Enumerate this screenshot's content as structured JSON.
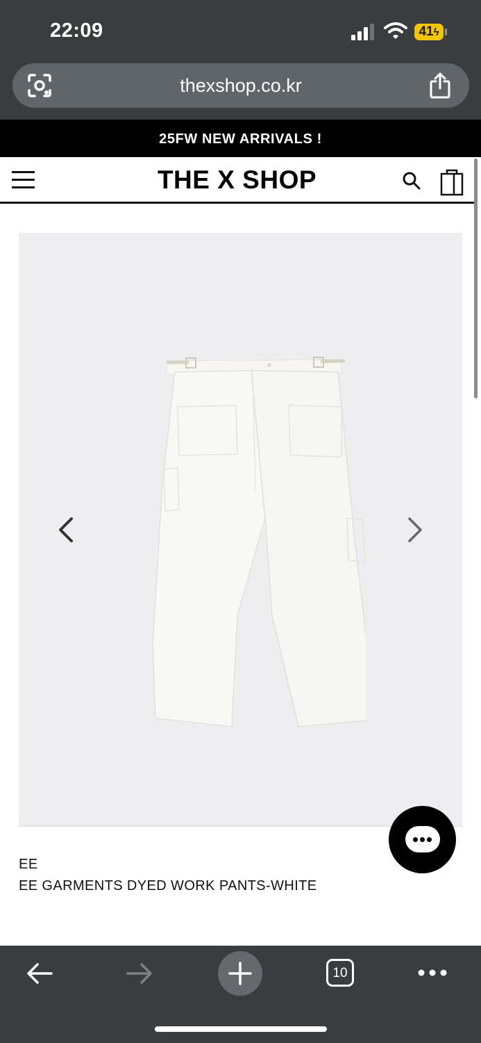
{
  "status_bar": {
    "time": "22:09",
    "battery": "41",
    "icons": [
      "signal-icon",
      "wifi-icon",
      "battery-icon"
    ]
  },
  "browser": {
    "url": "thexshop.co.kr",
    "icons": [
      "lens-icon",
      "share-icon"
    ],
    "bottom_icons": [
      "back-arrow-icon",
      "forward-arrow-icon",
      "plus-icon",
      "more-icon"
    ],
    "tab_count": "10"
  },
  "announcement": {
    "text": "25FW NEW ARRIVALS !"
  },
  "header": {
    "logo": "THE X SHOP",
    "icons": [
      "menu-icon",
      "search-icon",
      "shopping-bag-icon"
    ]
  },
  "product": {
    "brand": "EE",
    "name": "EE GARMENTS DYED WORK PANTS-WHITE",
    "gallery_icons": [
      "chevron-left-icon",
      "chevron-right-icon"
    ]
  },
  "chat": {
    "icon": "chat-icon"
  },
  "colors": {
    "browser_chrome": "#3a3d40",
    "address_bar": "#60656a",
    "battery": "#f2c500",
    "gallery_bg": "#eeeef1",
    "announcement_bg": "#000000"
  }
}
